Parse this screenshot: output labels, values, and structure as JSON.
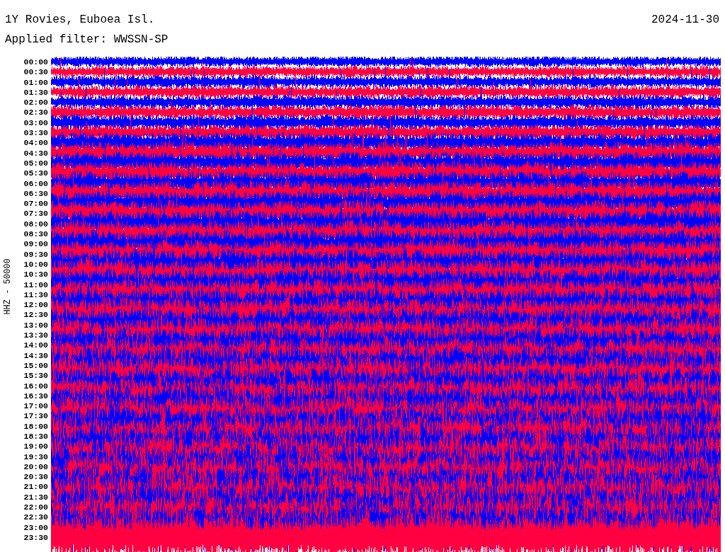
{
  "title": "1Y Rovies, Euboea Isl.",
  "date": "2024-11-30",
  "filter": "Applied filter: WWSSN-SP",
  "channel_label": "HHZ - 50000",
  "traces": [
    {
      "label": "00:00"
    },
    {
      "label": "00:30"
    },
    {
      "label": "01:00"
    },
    {
      "label": "01:30"
    },
    {
      "label": "02:00"
    },
    {
      "label": "02:30"
    },
    {
      "label": "03:00"
    },
    {
      "label": "03:30"
    },
    {
      "label": "04:00"
    },
    {
      "label": "04:30"
    },
    {
      "label": "05:00"
    },
    {
      "label": "05:30"
    },
    {
      "label": "06:00"
    },
    {
      "label": "06:30"
    },
    {
      "label": "07:00"
    },
    {
      "label": "07:30"
    },
    {
      "label": "08:00"
    },
    {
      "label": "08:30"
    },
    {
      "label": "09:00"
    },
    {
      "label": "09:30"
    },
    {
      "label": "10:00"
    },
    {
      "label": "10:30"
    },
    {
      "label": "11:00"
    },
    {
      "label": "11:30"
    },
    {
      "label": "12:00"
    },
    {
      "label": "12:30"
    },
    {
      "label": "13:00"
    },
    {
      "label": "13:30"
    },
    {
      "label": "14:00"
    },
    {
      "label": "14:30"
    },
    {
      "label": "15:00"
    },
    {
      "label": "15:30"
    },
    {
      "label": "16:00"
    },
    {
      "label": "16:30"
    },
    {
      "label": "17:00"
    },
    {
      "label": "17:30"
    },
    {
      "label": "18:00"
    },
    {
      "label": "18:30"
    },
    {
      "label": "19:00"
    },
    {
      "label": "19:30"
    },
    {
      "label": "20:00"
    },
    {
      "label": "20:30"
    },
    {
      "label": "21:00"
    },
    {
      "label": "21:30"
    },
    {
      "label": "22:00"
    },
    {
      "label": "22:30"
    },
    {
      "label": "23:00"
    },
    {
      "label": "23:30"
    }
  ]
}
